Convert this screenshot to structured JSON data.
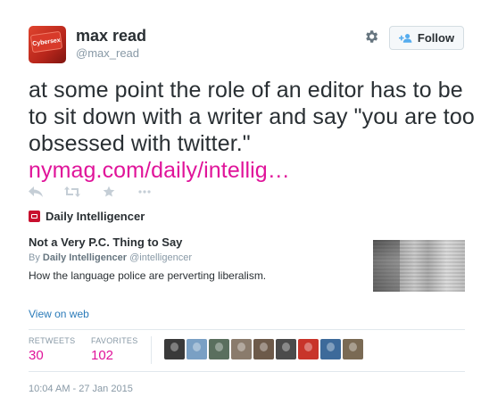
{
  "author": {
    "name": "max read",
    "handle": "@max_read",
    "avatar_label": "Cybersex",
    "avatar_color": "#d83a2a"
  },
  "follow_button": {
    "label": "Follow",
    "icon": "person-add-icon"
  },
  "tweet": {
    "text": "at some point the role of an editor has to be to sit down with a writer and say \"you are too obsessed with twitter.\"",
    "link": "nymag.com/daily/intellig…",
    "link_color": "#e0149a"
  },
  "actions": [
    "reply-icon",
    "retweet-icon",
    "favorite-icon",
    "more-icon"
  ],
  "card": {
    "source_name": "Daily Intelligencer",
    "title": "Not a Very P.C. Thing to Say",
    "by_prefix": "By",
    "by_name": "Daily Intelligencer",
    "by_handle": "@intelligencer",
    "description": "How the language police are perverting liberalism."
  },
  "view_on_web": "View on web",
  "stats": {
    "retweets_label": "RETWEETS",
    "retweets_value": "30",
    "favorites_label": "FAVORITES",
    "favorites_value": "102"
  },
  "favoriters": [
    {
      "color": "#3a3a3a"
    },
    {
      "color": "#7aa0c4"
    },
    {
      "color": "#5a6f5e"
    },
    {
      "color": "#8a7b6c"
    },
    {
      "color": "#6d5a4a"
    },
    {
      "color": "#4b4b4b"
    },
    {
      "color": "#c8342a"
    },
    {
      "color": "#3d6a9a"
    },
    {
      "color": "#7a6a54"
    }
  ],
  "timestamp": "10:04 AM - 27 Jan 2015"
}
